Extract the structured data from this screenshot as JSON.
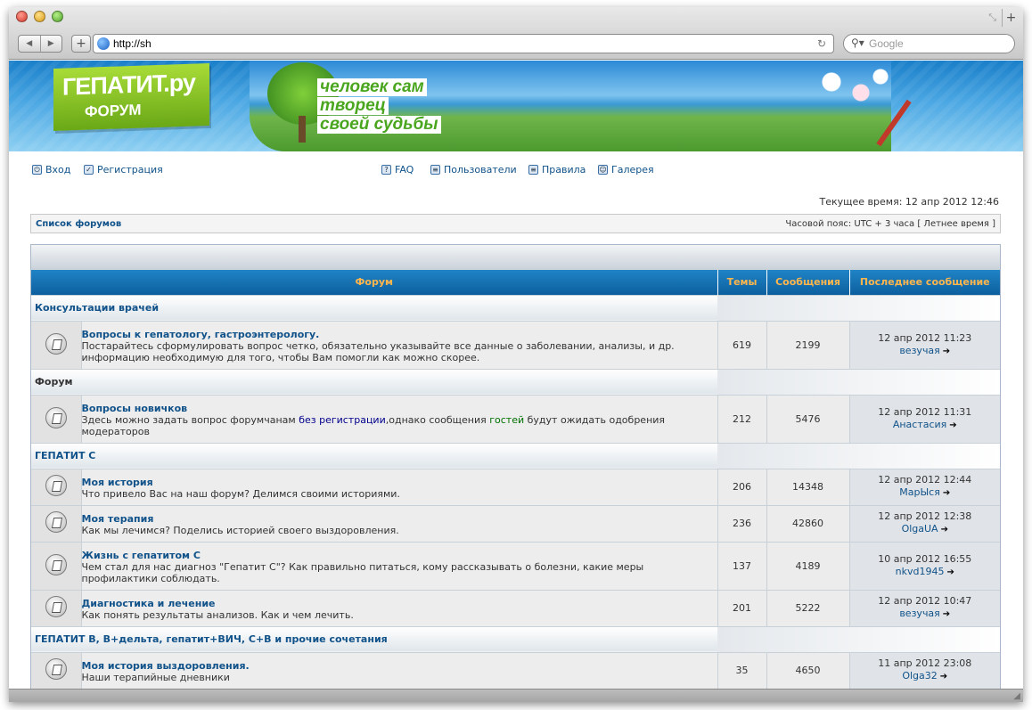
{
  "browser": {
    "url": "http://sh",
    "search_placeholder": "Google"
  },
  "banner": {
    "logo_title": "ГЕПАТИТ.ру",
    "logo_sub": "ФОРУМ",
    "slogan": [
      "человек сам",
      "творец",
      "своей судьбы"
    ]
  },
  "nav": {
    "login": "Вход",
    "register": "Регистрация",
    "faq": "FAQ",
    "users": "Пользователи",
    "rules": "Правила",
    "gallery": "Галерея"
  },
  "current_time": "Текущее время: 12 апр 2012 12:46",
  "breadcrumb": {
    "left": "Список форумов",
    "right": "Часовой пояс: UTC + 3 часа [ Летнее время ]"
  },
  "table": {
    "headers": {
      "forum": "Форум",
      "topics": "Темы",
      "posts": "Сообщения",
      "last": "Последнее сообщение"
    },
    "categories": [
      {
        "name": "Консультации врачей",
        "forums": [
          {
            "title": "Вопросы к гепатологу, гастроэнтерологу.",
            "desc": "Постарайтесь сформулировать вопрос четко, обязательно указывайте все данные о заболевании, анализы, и др. информацию необходимую для того, чтобы Вам помогли как можно скорее.",
            "topics": "619",
            "posts": "2199",
            "last_date": "12 апр 2012 11:23",
            "last_user": "везучая"
          }
        ]
      },
      {
        "name": "Форум",
        "forums": [
          {
            "title": "Вопросы новичков",
            "desc_a": "Здесь можно задать вопрос форумчанам ",
            "desc_b": "без регистрации",
            "desc_c": ",однако сообщения ",
            "desc_d": "гостей",
            "desc_e": " будут ожидать одобрения модераторов",
            "topics": "212",
            "posts": "5476",
            "last_date": "12 апр 2012 11:31",
            "last_user": "Анастасия"
          }
        ]
      },
      {
        "name": "ГЕПАТИТ С",
        "forums": [
          {
            "title": "Моя история",
            "desc": "Что привело Вас на наш форум? Делимся своими историями.",
            "topics": "206",
            "posts": "14348",
            "last_date": "12 апр 2012 12:44",
            "last_user": "МарЫся"
          },
          {
            "title": "Моя терапия",
            "desc": "Как мы лечимся? Поделись историей своего выздоровления.",
            "topics": "236",
            "posts": "42860",
            "last_date": "12 апр 2012 12:38",
            "last_user": "OlgaUA"
          },
          {
            "title": "Жизнь с гепатитом С",
            "desc": "Чем стал для нас диагноз \"Гепатит С\"? Как правильно питаться, кому рассказывать о болезни, какие меры профилактики соблюдать.",
            "topics": "137",
            "posts": "4189",
            "last_date": "10 апр 2012 16:55",
            "last_user": "nkvd1945"
          },
          {
            "title": "Диагностика и лечение",
            "desc": "Как понять результаты анализов. Как и чем лечить.",
            "topics": "201",
            "posts": "5222",
            "last_date": "12 апр 2012 10:47",
            "last_user": "везучая"
          }
        ]
      },
      {
        "name": "ГЕПАТИТ В, В+дельта, гепатит+ВИЧ, С+В и прочие сочетания",
        "forums": [
          {
            "title": "Моя история выздоровления.",
            "desc": "Наши терапийные дневники",
            "topics": "35",
            "posts": "4650",
            "last_date": "11 апр 2012 23:08",
            "last_user": "Olga32"
          }
        ]
      }
    ]
  }
}
